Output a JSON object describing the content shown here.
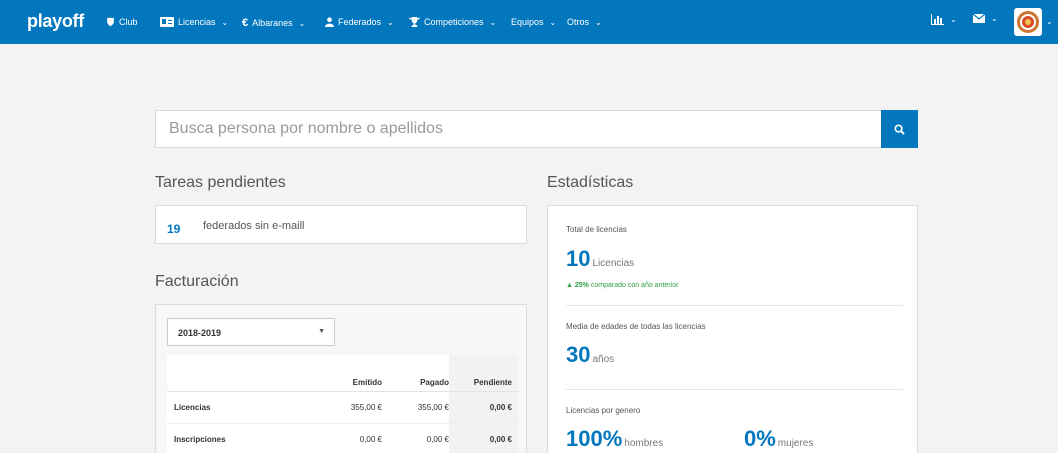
{
  "nav": {
    "brand": "playoff",
    "items": [
      {
        "label": "Club",
        "icon": "shield-icon",
        "dropdown": false
      },
      {
        "label": "Licencias",
        "icon": "id-card-icon",
        "dropdown": true
      },
      {
        "label": "Albaranes",
        "icon": "euro-icon",
        "dropdown": true
      },
      {
        "label": "Federados",
        "icon": "user-icon",
        "dropdown": true
      },
      {
        "label": "Competiciones",
        "icon": "trophy-icon",
        "dropdown": true
      },
      {
        "label": "Equipos",
        "icon": "",
        "dropdown": true
      },
      {
        "label": "Otros",
        "icon": "",
        "dropdown": true
      }
    ],
    "right": {
      "chart_icon": "bar-chart-icon",
      "mail_icon": "envelope-icon"
    }
  },
  "search": {
    "placeholder": "Busca persona por nombre o apellidos",
    "button_icon": "search-icon"
  },
  "tasks": {
    "title": "Tareas pendientes",
    "items": [
      {
        "count": "19",
        "text": "federados sin e-maill"
      }
    ]
  },
  "billing": {
    "title": "Facturación",
    "season": "2018-2019",
    "columns": [
      "Emitido",
      "Pagado",
      "Pendiente"
    ],
    "rows": [
      {
        "label": "Licencias",
        "emitido": "355,00 €",
        "pagado": "355,00 €",
        "pendiente": "0,00 €"
      },
      {
        "label": "Inscripciones",
        "emitido": "0,00 €",
        "pagado": "0,00 €",
        "pendiente": "0,00 €"
      }
    ]
  },
  "stats": {
    "title": "Estadísticas",
    "total": {
      "label": "Total de licencias",
      "value": "10",
      "unit": "Licencias",
      "change": "25%",
      "change_text": "comparado con año anterior"
    },
    "age": {
      "label": "Media de edades de todas las licencias",
      "value": "30",
      "unit": "años"
    },
    "gender": {
      "label": "Licencias por genero",
      "men_value": "100%",
      "men_unit": "hombres",
      "women_value": "0%",
      "women_unit": "mujeres"
    }
  },
  "colors": {
    "primary": "#0277bd",
    "positive": "#2e9e45",
    "background": "#f3f3f3"
  }
}
